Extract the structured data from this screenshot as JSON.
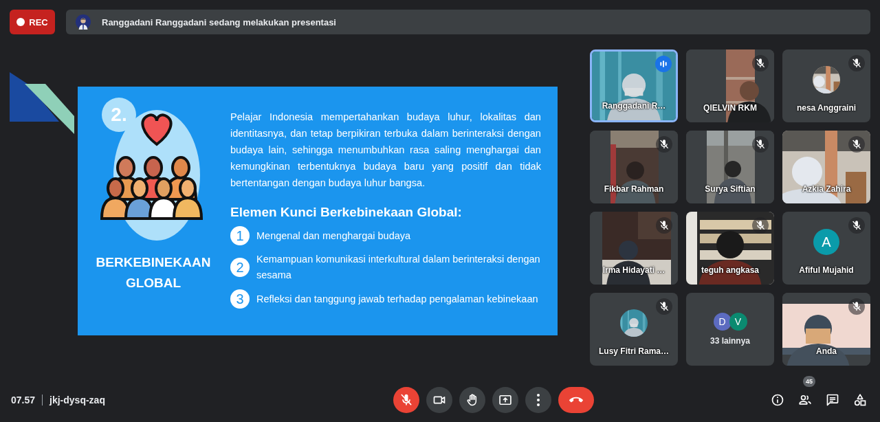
{
  "recording": {
    "label": "REC"
  },
  "banner": {
    "text": "Ranggadani Ranggadani sedang melakukan presentasi"
  },
  "slide": {
    "number": "2.",
    "title": "BERKEBINEKAAN GLOBAL",
    "paragraph": "Pelajar Indonesia mempertahankan budaya luhur, lokalitas dan identitasnya, dan tetap berpikiran terbuka dalam berinteraksi dengan budaya lain, sehingga menumbuhkan rasa saling menghargai dan kemungkinan terbentuknya budaya baru yang positif dan tidak bertentangan dengan budaya luhur bangsa.",
    "heading": "Elemen Kunci Berkebinekaan Global:",
    "elements": [
      {
        "number": "1",
        "text": "Mengenal dan menghargai budaya"
      },
      {
        "number": "2",
        "text": "Kemampuan komunikasi interkultural dalam berinteraksi dengan sesama"
      },
      {
        "number": "3",
        "text": "Refleksi dan tanggung jawab terhadap pengalaman kebinekaan"
      }
    ]
  },
  "tiles": [
    {
      "kind": "video",
      "name": "Ranggadani R…",
      "muted": false,
      "speaking": true
    },
    {
      "kind": "video",
      "name": "QIELVIN RKM",
      "muted": true,
      "speaking": false
    },
    {
      "name": "nesa Anggraini",
      "muted": true,
      "speaking": false
    },
    {
      "kind": "video",
      "name": "Fikbar Rahman",
      "muted": true,
      "speaking": false
    },
    {
      "kind": "video",
      "name": "Surya Siftian",
      "muted": true,
      "speaking": false
    },
    {
      "kind": "video",
      "name": "Azkia Zahira",
      "muted": true,
      "speaking": false
    },
    {
      "kind": "video",
      "name": "Irma Hidayati …",
      "muted": true,
      "speaking": false
    },
    {
      "kind": "video",
      "name": "teguh angkasa",
      "muted": true,
      "speaking": false
    },
    {
      "kind": "letter",
      "name": "Afiful Mujahid",
      "initial": "A",
      "color": "#0a9baa",
      "muted": true,
      "speaking": false
    },
    {
      "name": "Lusy Fitri Rama…",
      "muted": true,
      "speaking": false
    },
    {
      "kind": "others",
      "name": "33 lainnya",
      "avatars": [
        {
          "initial": "D",
          "color": "#5c6bc0"
        },
        {
          "initial": "V",
          "color": "#0b8a70"
        }
      ],
      "muted": false,
      "speaking": false
    },
    {
      "kind": "video",
      "name": "Anda",
      "muted": true,
      "speaking": false
    }
  ],
  "bottom_bar": {
    "time": "07.57",
    "meeting_code": "jkj-dysq-zaq",
    "controls": [
      {
        "kind": "mic",
        "on": false
      },
      {
        "kind": "camera",
        "on": true
      },
      {
        "kind": "hand"
      },
      {
        "kind": "present"
      },
      {
        "kind": "more"
      },
      {
        "kind": "end"
      }
    ],
    "participant_count": "45"
  }
}
